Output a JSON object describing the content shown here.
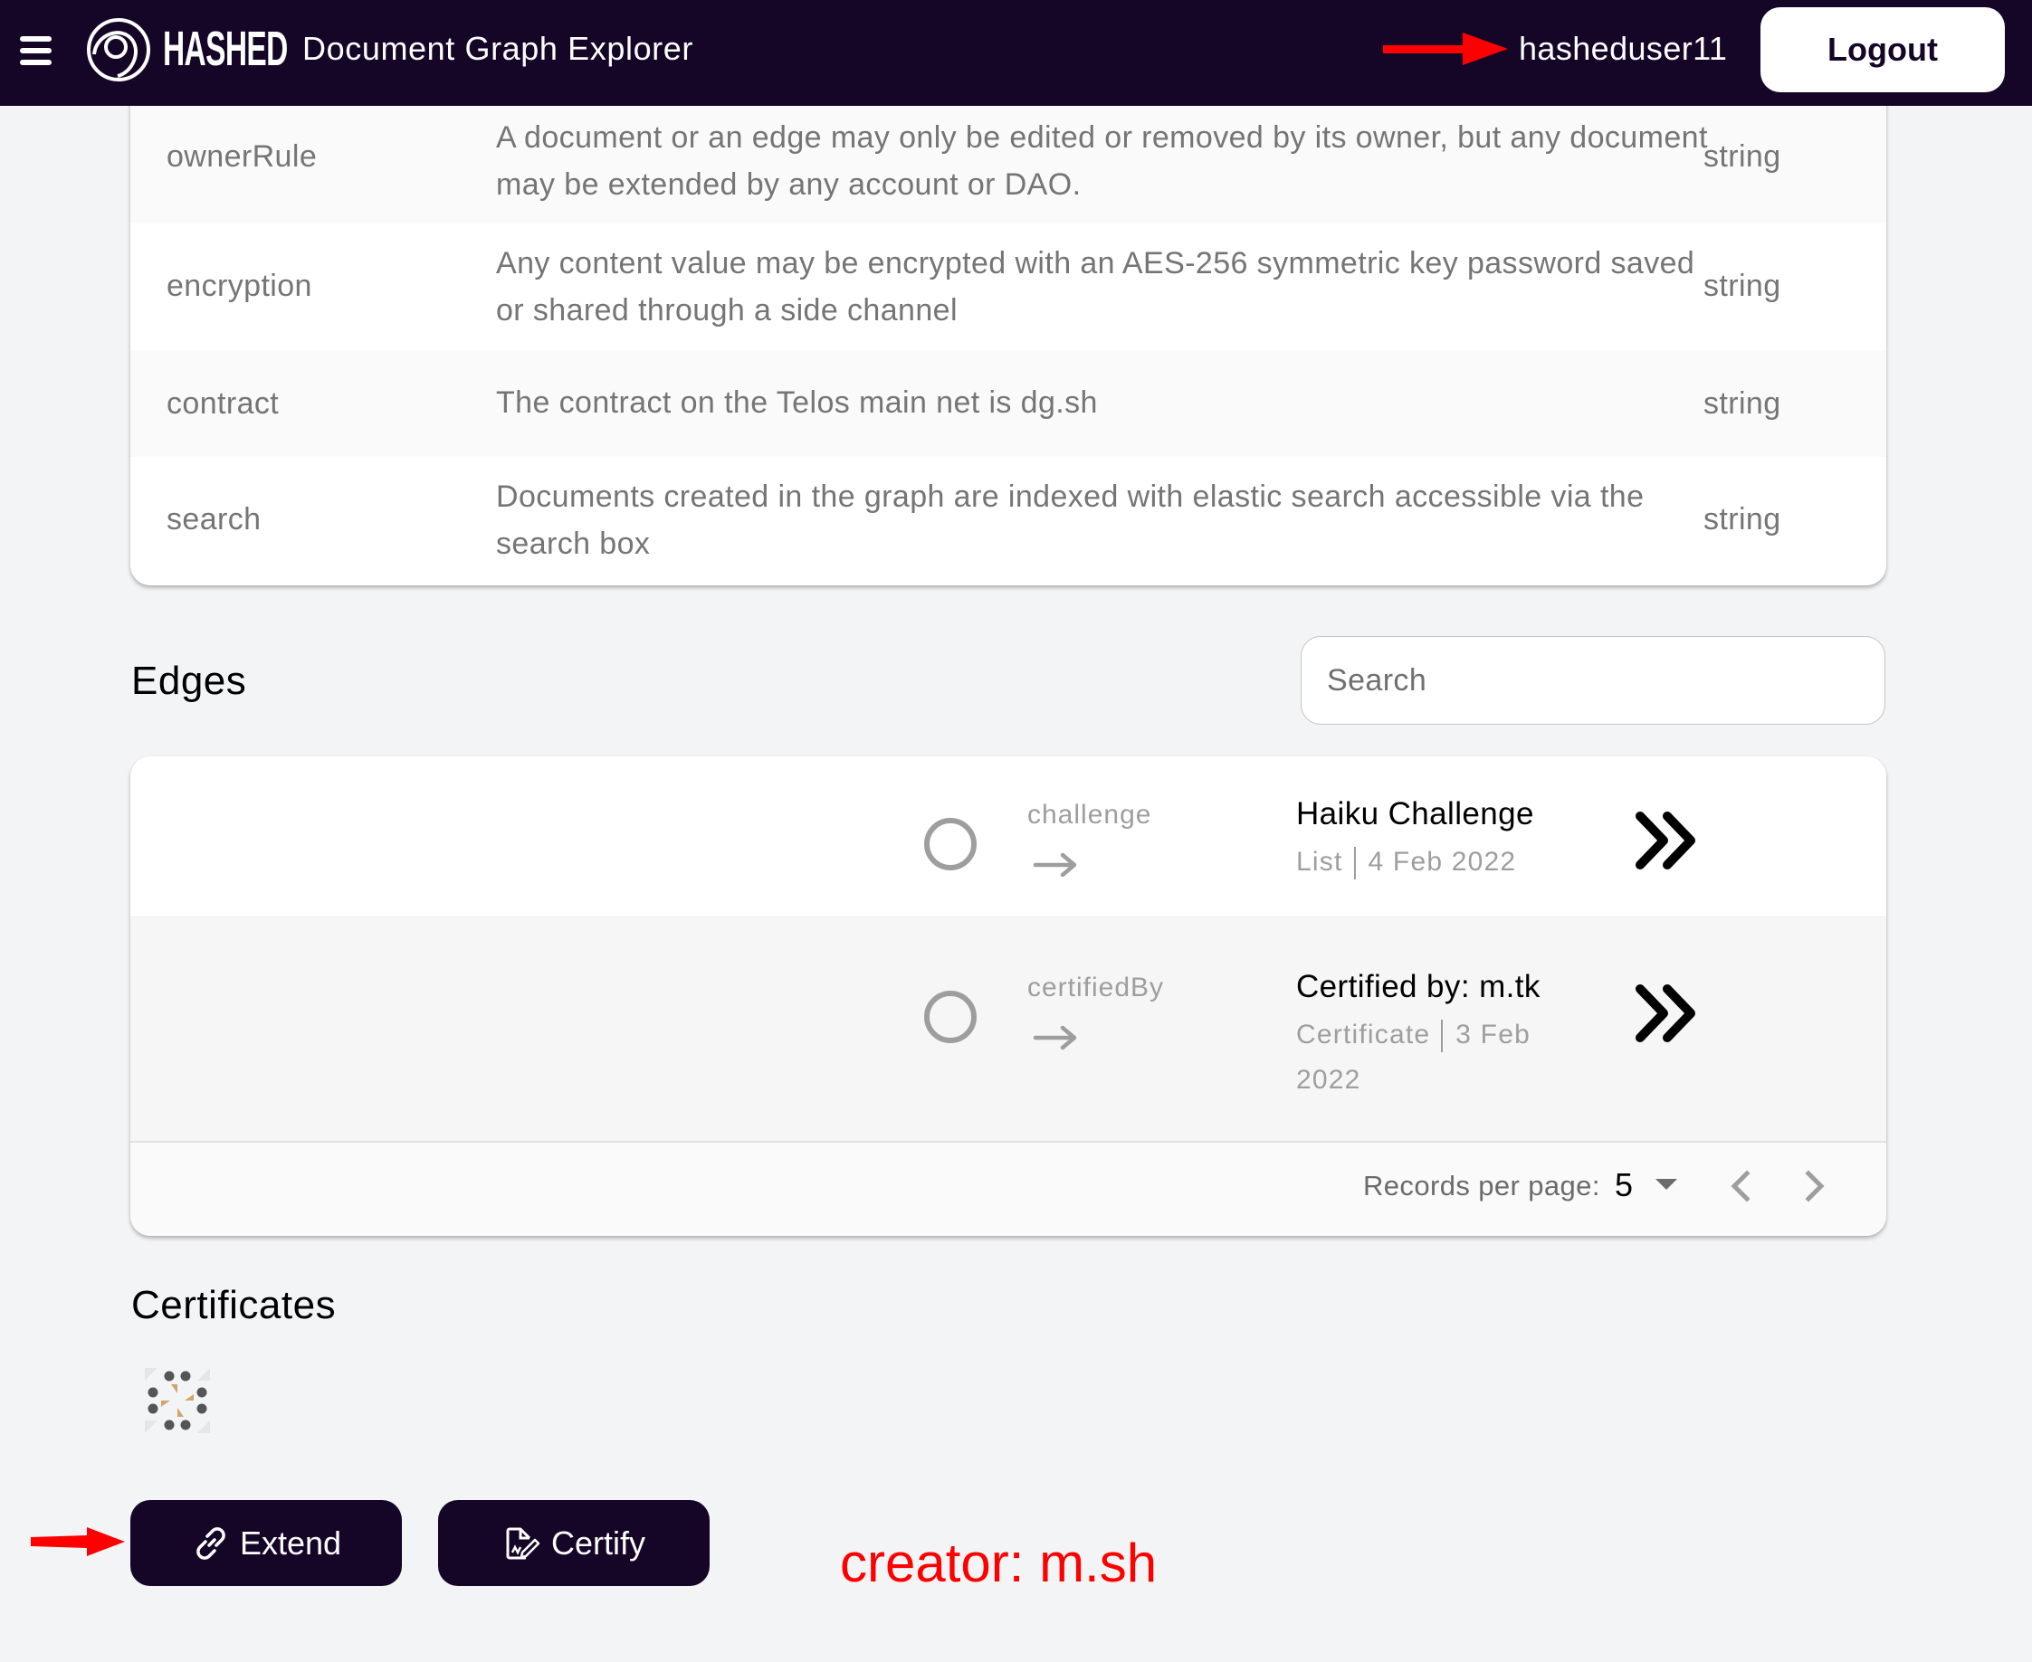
{
  "header": {
    "menu_icon": "hamburger-icon",
    "brand": "HASHED",
    "app_title": "Document Graph Explorer",
    "username": "hasheduser11",
    "logout_label": "Logout",
    "colors": {
      "background": "#150627",
      "text": "#ffffff"
    }
  },
  "attributes": {
    "rows": [
      {
        "key": "ownerRule",
        "description": "A document or an edge may only be edited or removed by its owner, but any document may be extended by any account or DAO.",
        "type": "string"
      },
      {
        "key": "encryption",
        "description": "Any content value may be encrypted with an AES-256 symmetric key password saved or shared through a side channel",
        "type": "string"
      },
      {
        "key": "contract",
        "description": "The contract on the Telos main net is dg.sh",
        "type": "string"
      },
      {
        "key": "search",
        "description": "Documents created in the graph are indexed with elastic search accessible via the search box",
        "type": "string"
      }
    ]
  },
  "edges": {
    "title": "Edges",
    "search_placeholder": "Search",
    "search_value": "",
    "rows": [
      {
        "edge_name": "challenge",
        "title": "Haiku Challenge",
        "doc_type": "List",
        "date": "4 Feb 2022",
        "open_icon": "double-chevron-right-icon"
      },
      {
        "edge_name": "certifiedBy",
        "title": "Certified by: m.tk",
        "doc_type": "Certificate",
        "date": "3 Feb 2022",
        "open_icon": "double-chevron-right-icon"
      }
    ],
    "pagination": {
      "records_per_page_label": "Records per page:",
      "records_per_page": "5",
      "prev_icon": "chevron-left-icon",
      "next_icon": "chevron-right-icon"
    }
  },
  "certificates": {
    "title": "Certificates",
    "items": [
      {
        "avatar": "identicon-avatar"
      }
    ]
  },
  "actions": {
    "extend_label": "Extend",
    "extend_icon": "link-icon",
    "certify_label": "Certify",
    "certify_icon": "document-sign-icon"
  },
  "annotations": {
    "creator_note": "creator: m.sh",
    "color": "#ff0000"
  }
}
